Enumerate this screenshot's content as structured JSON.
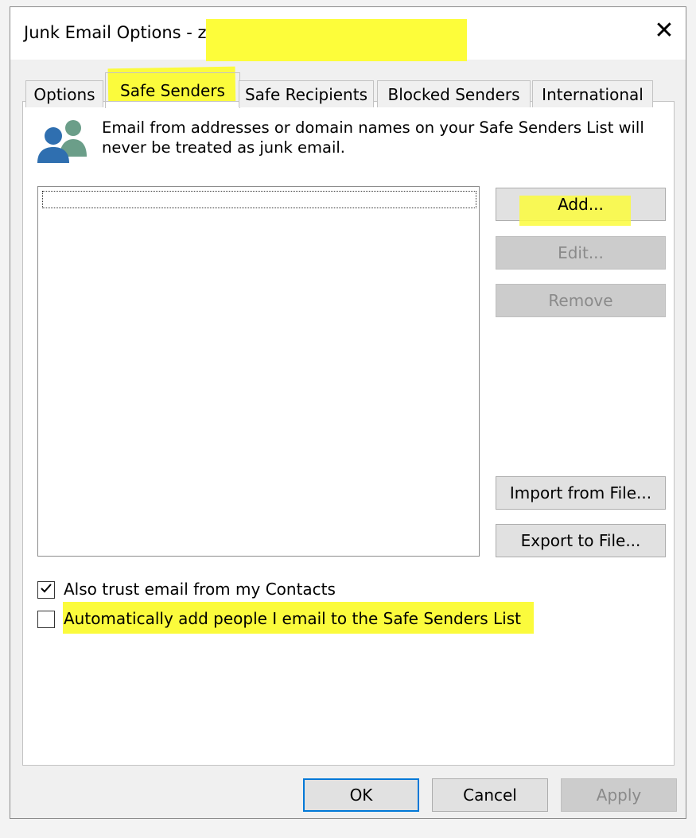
{
  "dialog": {
    "title": "Junk Email Options - z",
    "close_glyph": "✕"
  },
  "tabs": [
    {
      "label": "Options",
      "active": false
    },
    {
      "label": "Safe Senders",
      "active": true
    },
    {
      "label": "Safe Recipients",
      "active": false
    },
    {
      "label": "Blocked Senders",
      "active": false
    },
    {
      "label": "International",
      "active": false
    }
  ],
  "panel": {
    "icon": "people-icon",
    "description": "Email from addresses or domain names on your Safe Senders List will\nnever be treated as junk email.",
    "list_items": [],
    "buttons": {
      "add": "Add...",
      "edit": "Edit...",
      "remove": "Remove",
      "import": "Import from File...",
      "export": "Export to File..."
    },
    "checkboxes": [
      {
        "label": "Also trust email from my Contacts",
        "checked": true
      },
      {
        "label": "Automatically add people I email to the Safe Senders List",
        "checked": false
      }
    ]
  },
  "footer": {
    "ok": "OK",
    "cancel": "Cancel",
    "apply": "Apply"
  },
  "colors": {
    "highlight": "#fbfb3c",
    "default_button_border": "#0078d7",
    "icon_blue": "#2f6fb0",
    "icon_green": "#6b9e89"
  }
}
